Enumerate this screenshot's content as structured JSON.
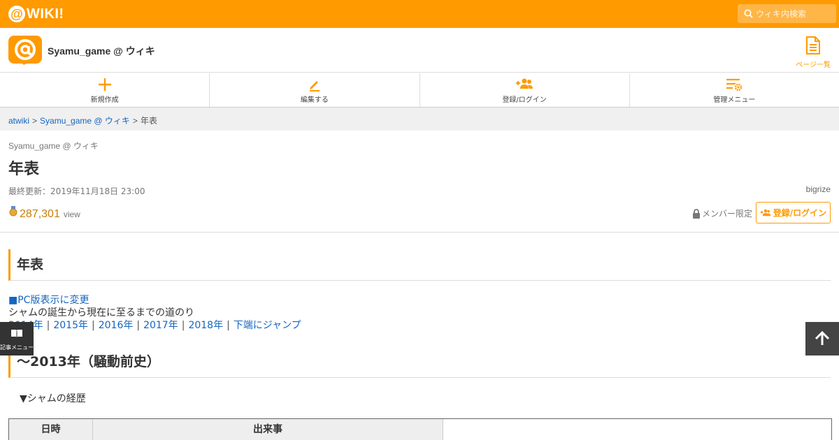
{
  "site": {
    "logo_text": "WIKI!",
    "accent_color": "#ff9a00"
  },
  "search": {
    "placeholder": "ウィキ内検索"
  },
  "wiki": {
    "title": "Syamu_game @ ウィキ",
    "page_list_label": "ページ一覧"
  },
  "actions": [
    {
      "label": "新規作成",
      "icon": "plus-icon"
    },
    {
      "label": "編集する",
      "icon": "pencil-icon"
    },
    {
      "label": "登録/ログイン",
      "icon": "user-add-icon"
    },
    {
      "label": "管理メニュー",
      "icon": "settings-list-icon"
    }
  ],
  "breadcrumb": [
    "atwiki",
    "Syamu_game @ ウィキ",
    "年表"
  ],
  "page": {
    "wiki_name": "Syamu_game @ ウィキ",
    "title": "年表",
    "updated": "最終更新：2019年11月18日 23:00",
    "author": "bigrize",
    "views": "287,301",
    "views_unit": "view",
    "member_only": "メンバー限定",
    "login_button": "登録/ログイン"
  },
  "content": {
    "heading1": "年表",
    "pc_link": "■PC版表示に変更",
    "description": "シャムの誕生から現在に至るまでの道のり",
    "jump_links": [
      "2014年",
      "2015年",
      "2016年",
      "2017年",
      "2018年",
      "下端にジャンプ"
    ],
    "heading2": "～2013年（騒動前史）",
    "toggle": "▼シャムの経歴",
    "table_headers": [
      "日時",
      "出来事"
    ]
  },
  "floating": {
    "article_menu": "記事メニュー"
  }
}
